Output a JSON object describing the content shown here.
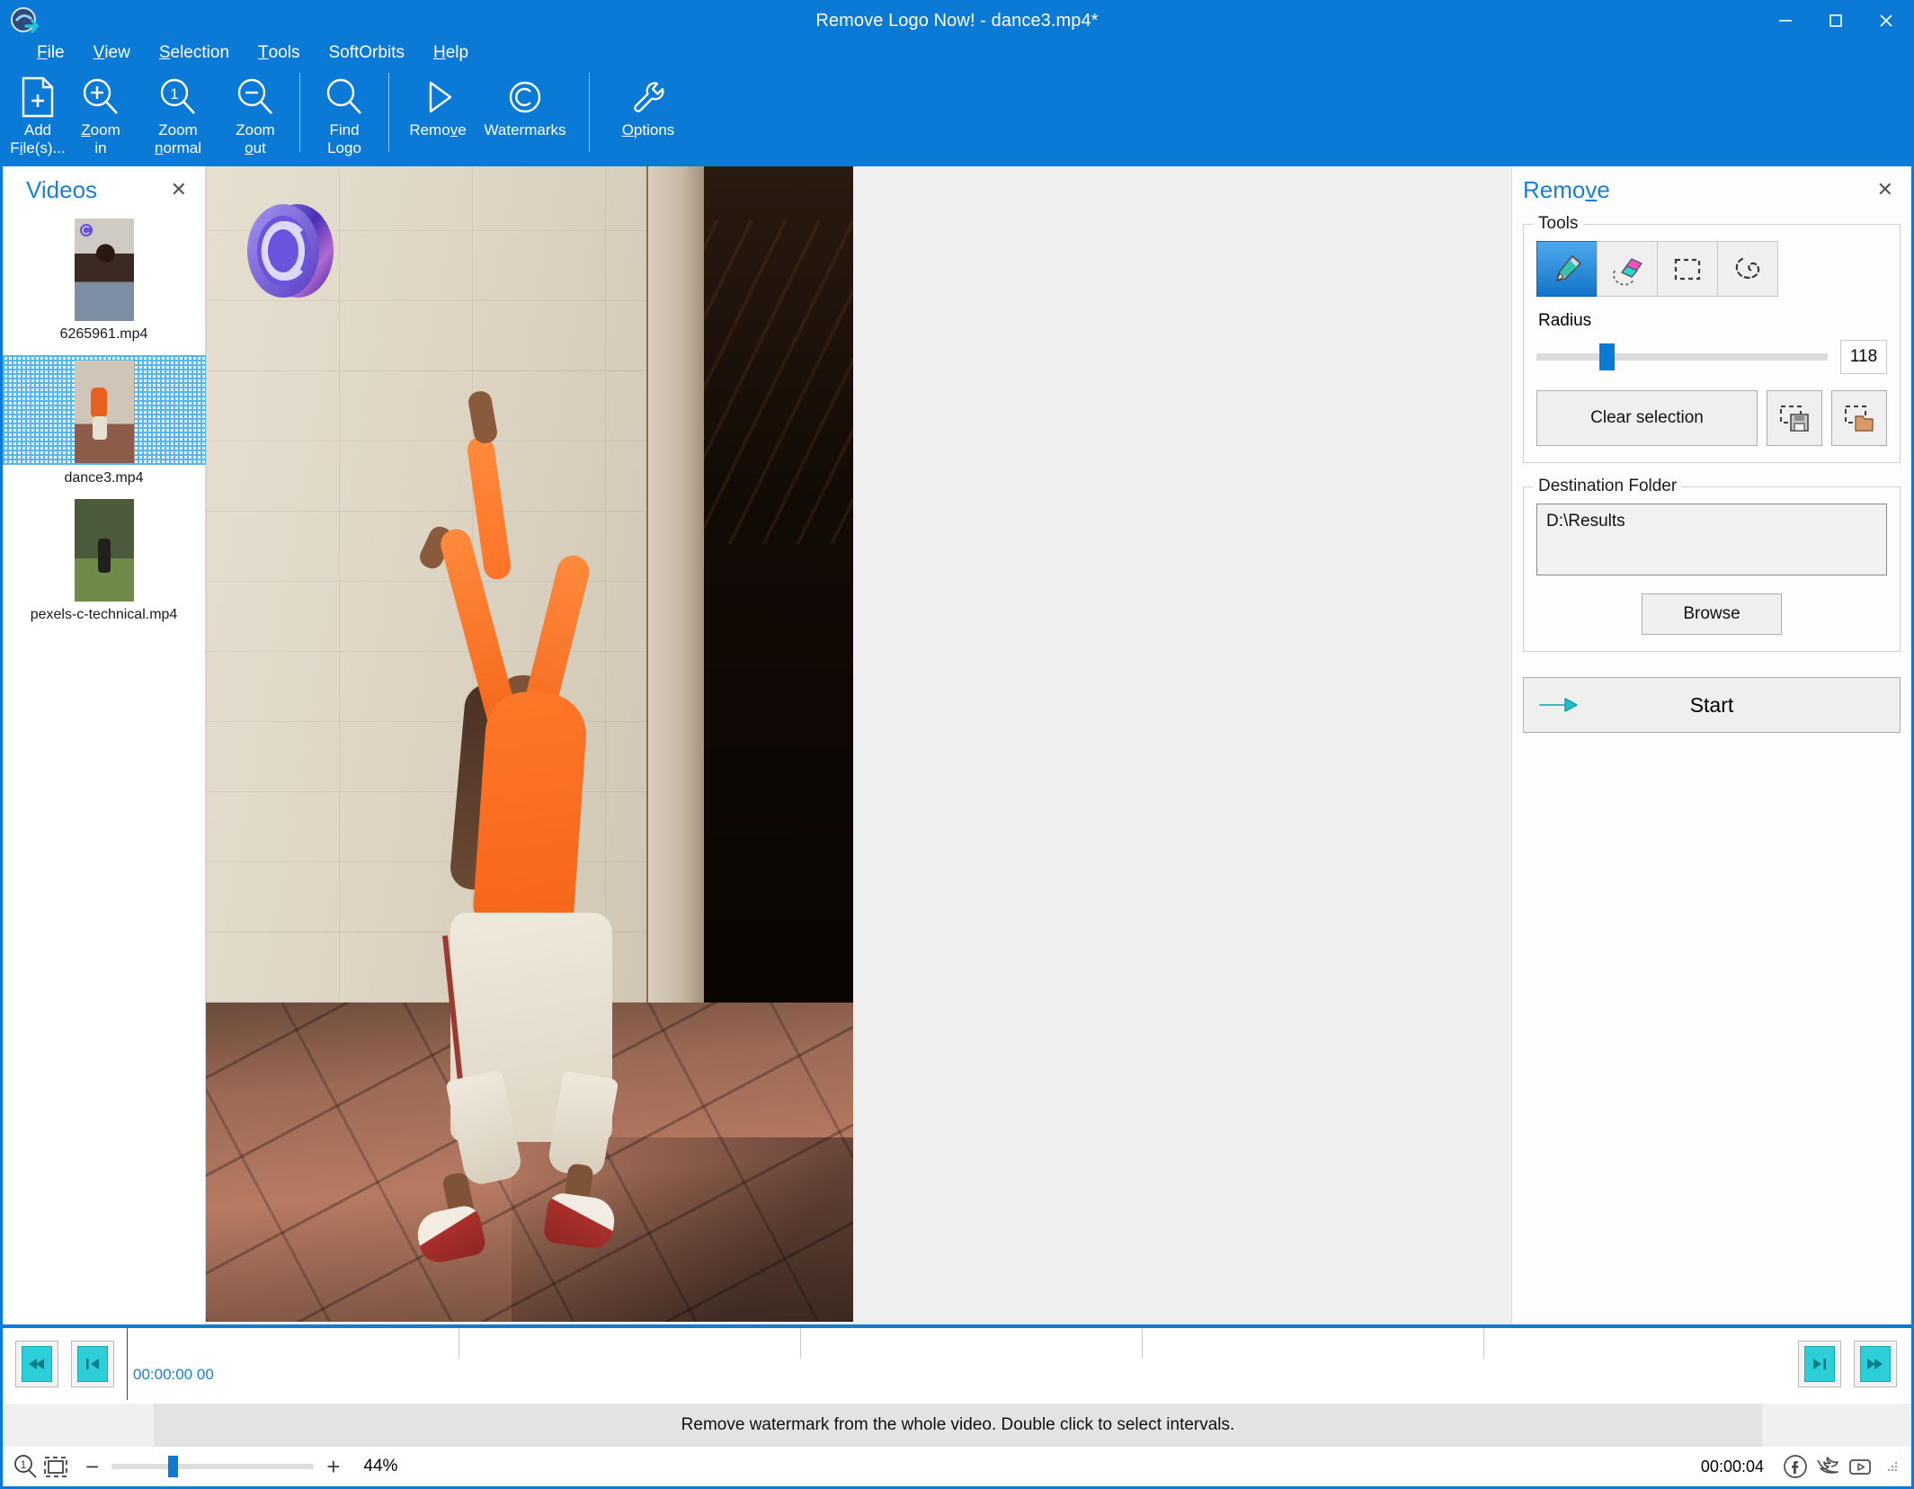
{
  "window": {
    "title": "Remove Logo Now! - dance3.mp4*",
    "accent_color": "#0a7ad6",
    "controls": [
      "minimize",
      "maximize",
      "close"
    ]
  },
  "menubar": {
    "items": [
      {
        "label": "File",
        "accel": "F"
      },
      {
        "label": "View",
        "accel": "V"
      },
      {
        "label": "Selection",
        "accel": "S"
      },
      {
        "label": "Tools",
        "accel": "T"
      },
      {
        "label": "SoftOrbits",
        "accel": ""
      },
      {
        "label": "Help",
        "accel": "H"
      }
    ]
  },
  "toolbar": {
    "buttons": [
      {
        "name": "add-files",
        "label": "Add\nFile(s)...",
        "icon": "file-plus-icon"
      },
      {
        "name": "zoom-in",
        "label": "Zoom\nin",
        "icon": "zoom-in-icon"
      },
      {
        "name": "zoom-normal",
        "label": "Zoom\nnormal",
        "icon": "zoom-one-icon"
      },
      {
        "name": "zoom-out",
        "label": "Zoom\nout",
        "icon": "zoom-out-icon"
      },
      {
        "name": "find-logo",
        "label": "Find\nLogo",
        "icon": "magnifier-icon"
      },
      {
        "name": "remove",
        "label": "Remove",
        "icon": "play-triangle-icon"
      },
      {
        "name": "watermarks",
        "label": "Watermarks",
        "icon": "copyright-icon"
      },
      {
        "name": "options",
        "label": "Options",
        "icon": "wrench-icon"
      }
    ]
  },
  "videos_panel": {
    "title": "Videos",
    "close_label": "✕",
    "items": [
      {
        "name": "6265961.mp4",
        "selected": false
      },
      {
        "name": "dance3.mp4",
        "selected": true
      },
      {
        "name": "pexels-c-technical.mp4",
        "selected": false
      }
    ]
  },
  "remove_panel": {
    "title": "Remove",
    "title_accel": "v",
    "close_label": "✕",
    "tools_group_label": "Tools",
    "tools": [
      {
        "name": "marker-tool",
        "icon": "marker-pen-icon",
        "active": true
      },
      {
        "name": "eraser-tool",
        "icon": "eraser-icon",
        "active": false
      },
      {
        "name": "rectangle-select-tool",
        "icon": "dashed-rectangle-icon",
        "active": false
      },
      {
        "name": "lasso-select-tool",
        "icon": "lasso-icon",
        "active": false
      }
    ],
    "radius_label": "Radius",
    "radius_value": "118",
    "radius_percent": 24,
    "clear_selection_label": "Clear selection",
    "save_selection_icon": "save-selection-icon",
    "load_selection_icon": "open-selection-icon",
    "destination_group_label": "Destination Folder",
    "destination_path": "D:\\Results",
    "browse_label": "Browse",
    "start_label": "Start",
    "start_icon": "arrow-right-icon"
  },
  "timeline": {
    "skip_start_icon": "skip-to-start-icon",
    "step_back_icon": "step-back-icon",
    "step_forward_icon": "step-forward-icon",
    "skip_end_icon": "skip-to-end-icon",
    "current_time": "00:00:00 00"
  },
  "status": {
    "message": "Remove watermark from the whole video. Double click to select intervals."
  },
  "bottombar": {
    "zoom_normal_icon": "zoom-one-icon",
    "fit_icon": "fit-to-window-icon",
    "minus_label": "−",
    "plus_label": "+",
    "zoom_percent": "44%",
    "zoom_slider_percent": 30,
    "duration": "00:00:04",
    "social": [
      {
        "name": "facebook-icon"
      },
      {
        "name": "twitter-icon"
      },
      {
        "name": "youtube-icon"
      }
    ]
  },
  "canvas": {
    "watermark_icon": "copyright-3d-watermark",
    "watermark_color": "#6a4fd6"
  }
}
